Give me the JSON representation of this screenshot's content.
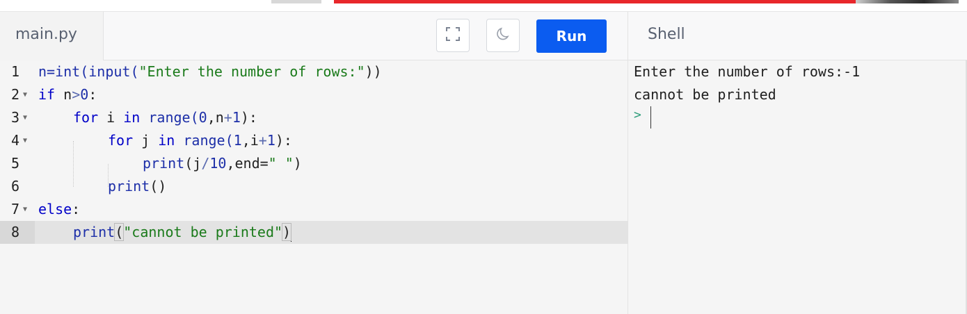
{
  "editor": {
    "file_tab": "main.py",
    "run_label": "Run",
    "fullscreen_icon": "fullscreen-icon",
    "theme_icon": "moon-icon",
    "accent_color": "#0b5cf0",
    "active_line": 8,
    "lines": [
      {
        "n": "1",
        "fold": ""
      },
      {
        "n": "2",
        "fold": "▼"
      },
      {
        "n": "3",
        "fold": "▼"
      },
      {
        "n": "4",
        "fold": "▼"
      },
      {
        "n": "5",
        "fold": ""
      },
      {
        "n": "6",
        "fold": ""
      },
      {
        "n": "7",
        "fold": "▼"
      },
      {
        "n": "8",
        "fold": ""
      }
    ],
    "code": {
      "l1": {
        "a": "n=int(input(",
        "b": "\"Enter the number of rows:\"",
        "c": "))"
      },
      "l2": {
        "a": "if",
        "b": " n",
        "c": ">",
        "d": "0",
        "e": ":"
      },
      "l3": {
        "a": "for",
        "b": " i ",
        "c": "in",
        "d": " range(",
        "e": "0",
        "f": ",n",
        "g": "+",
        "h": "1",
        "i": "):"
      },
      "l4": {
        "a": "for",
        "b": " j ",
        "c": "in",
        "d": " range(",
        "e": "1",
        "f": ",i",
        "g": "+",
        "h": "1",
        "i": "):"
      },
      "l5": {
        "a": "print",
        "b": "(j",
        "c": "/",
        "d": "10",
        "e": ",end=",
        "f": "\" \"",
        "g": ")"
      },
      "l6": {
        "a": "print",
        "b": "()"
      },
      "l7": {
        "a": "else",
        "b": ":"
      },
      "l8": {
        "a": "print",
        "b": "(",
        "c": "\"cannot be printed\"",
        "d": ")"
      }
    }
  },
  "shell": {
    "title": "Shell",
    "output": [
      "Enter the number of rows:-1",
      "cannot be printed"
    ],
    "prompt": ">"
  }
}
